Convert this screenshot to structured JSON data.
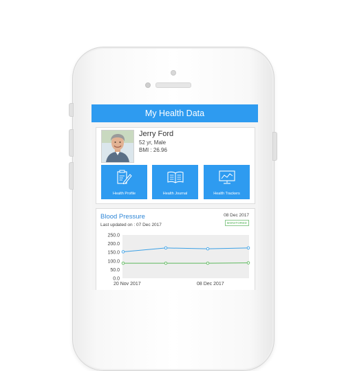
{
  "app": {
    "title": "My Health Data"
  },
  "profile": {
    "name": "Jerry Ford",
    "age_gender": "52 yr, Male",
    "bmi": "BMI : 26.96"
  },
  "tiles": [
    {
      "label": "Health Profile",
      "icon": "health-profile-icon"
    },
    {
      "label": "Health Journal",
      "icon": "health-journal-icon"
    },
    {
      "label": "Health Trackers",
      "icon": "health-trackers-icon"
    }
  ],
  "blood_pressure": {
    "title": "Blood Pressure",
    "updated": "Last updated on : 07 Dec 2017",
    "date": "08 Dec 2017",
    "status": "MONITORED"
  },
  "colors": {
    "accent": "#2e9bf0",
    "systolic": "#3aa0e6",
    "diastolic": "#5cb85c"
  },
  "chart_data": {
    "type": "line",
    "x_labels": [
      "20 Nov 2017",
      "08 Dec 2017"
    ],
    "y_ticks": [
      "250.0",
      "200.0",
      "150.0",
      "100.0",
      "50.0",
      "0.0"
    ],
    "ylim": [
      0,
      250
    ],
    "series": [
      {
        "values": [
          153,
          175,
          170,
          175
        ]
      },
      {
        "values": [
          87,
          87,
          87,
          89
        ]
      }
    ]
  }
}
